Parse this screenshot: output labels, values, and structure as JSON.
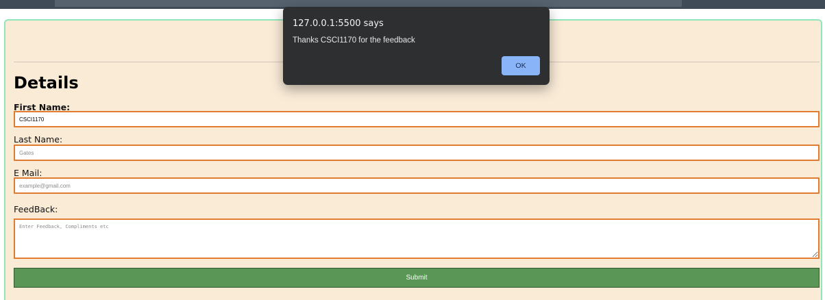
{
  "dialog": {
    "title": "127.0.0.1:5500 says",
    "message": "Thanks CSCI1170  for the feedback",
    "ok_label": "OK"
  },
  "form": {
    "heading": "Details",
    "first_name": {
      "label": "First Name:",
      "value": "CSCI1170"
    },
    "last_name": {
      "label": "Last Name:",
      "placeholder": "Gates"
    },
    "email": {
      "label": "E Mail:",
      "placeholder": "example@gmail.com"
    },
    "feedback": {
      "label": "FeedBack:",
      "placeholder": "Enter Feedback, Compliments etc"
    },
    "submit_label": "Submit"
  },
  "colors": {
    "page_background": "#faebd7",
    "card_border": "#8fe6b9",
    "input_border": "#e07b30",
    "submit_background": "#5a9656",
    "dialog_background": "#2e2f31",
    "ok_button": "#8ab4f8"
  }
}
